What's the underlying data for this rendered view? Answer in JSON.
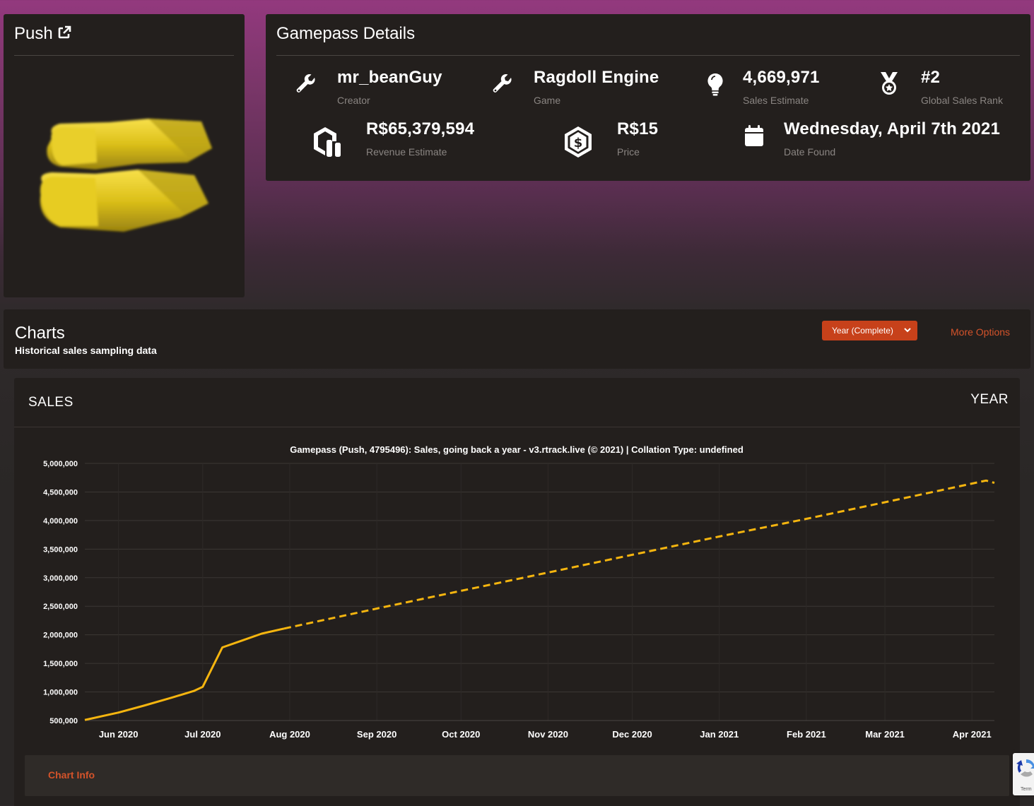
{
  "item": {
    "name": "Push"
  },
  "details": {
    "title": "Gamepass Details",
    "stats": [
      {
        "key": "creator",
        "value": "mr_beanGuy",
        "label": "Creator",
        "icon": "wrench-icon"
      },
      {
        "key": "game",
        "value": "Ragdoll Engine",
        "label": "Game",
        "icon": "wrench-icon"
      },
      {
        "key": "sales",
        "value": "4,669,971",
        "label": "Sales Estimate",
        "icon": "lightbulb-icon"
      },
      {
        "key": "rank",
        "value": "#2",
        "label": "Global Sales Rank",
        "icon": "medal-icon"
      },
      {
        "key": "revenue",
        "value": "R$65,379,594",
        "label": "Revenue Estimate",
        "icon": "robux-stack-icon"
      },
      {
        "key": "price",
        "value": "R$15",
        "label": "Price",
        "icon": "dollar-hexagon-icon"
      },
      {
        "key": "date",
        "value": "Wednesday, April 7th 2021",
        "label": "Date Found",
        "icon": "calendar-icon"
      }
    ]
  },
  "charts_section": {
    "title": "Charts",
    "subtitle": "Historical sales sampling data",
    "range_select": "Year (Complete)",
    "more_options": "More Options"
  },
  "chart_panel": {
    "title": "SALES",
    "range": "YEAR",
    "info_label": "Chart Info"
  },
  "recaptcha": {
    "text": "Term"
  },
  "colors": {
    "accent": "#c7411a",
    "link": "#d4532a",
    "line": "#f5b50f",
    "panel": "#231f1d"
  },
  "chart_data": {
    "type": "line",
    "title": "Gamepass (Push, 4795496): Sales, going back a year -  v3.rtrack.live (© 2021) | Collation Type: undefined",
    "xlabel": "",
    "ylabel": "",
    "x_ticks": [
      "Jun 2020",
      "Jul 2020",
      "Aug 2020",
      "Sep 2020",
      "Oct 2020",
      "Nov 2020",
      "Dec 2020",
      "Jan 2021",
      "Feb 2021",
      "Mar 2021",
      "Apr 2021"
    ],
    "y_ticks": [
      "500,000",
      "1,000,000",
      "1,500,000",
      "2,000,000",
      "2,500,000",
      "3,000,000",
      "3,500,000",
      "4,000,000",
      "4,500,000",
      "5,000,000"
    ],
    "ylim": [
      500000,
      5000000
    ],
    "xlim": [
      "2020-05-20",
      "2021-04-09"
    ],
    "grid": true,
    "series": [
      {
        "style": "solid",
        "x": [
          "2020-05-20",
          "2020-06-01",
          "2020-06-10",
          "2020-06-20",
          "2020-06-28",
          "2020-07-01",
          "2020-07-08",
          "2020-07-15",
          "2020-07-22",
          "2020-07-30"
        ],
        "y": [
          510000,
          640000,
          760000,
          900000,
          1020000,
          1090000,
          1780000,
          1900000,
          2020000,
          2110000
        ]
      },
      {
        "style": "dashed",
        "x": [
          "2020-07-30",
          "2020-09-01",
          "2020-10-01",
          "2020-11-01",
          "2020-12-01",
          "2021-01-01",
          "2021-02-01",
          "2021-03-01",
          "2021-04-06",
          "2021-04-09"
        ],
        "y": [
          2110000,
          2460000,
          2770000,
          3090000,
          3400000,
          3720000,
          4030000,
          4320000,
          4700000,
          4660000
        ]
      }
    ]
  }
}
